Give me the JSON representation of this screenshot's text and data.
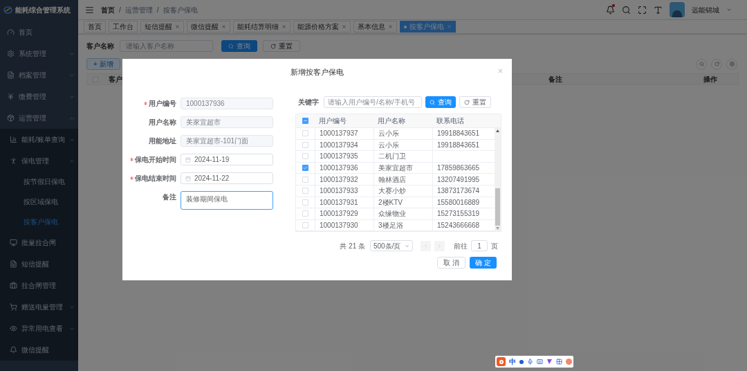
{
  "app_title": "能耗综合管理系统",
  "sidebar": [
    {
      "label": "首页",
      "has_children": false
    },
    {
      "label": "系统管理",
      "expanded": false,
      "has_children": true
    },
    {
      "label": "档案管理",
      "expanded": false,
      "has_children": true
    },
    {
      "label": "缴费管理",
      "expanded": false,
      "has_children": true
    },
    {
      "label": "运营管理",
      "expanded": true,
      "has_children": true,
      "children": [
        {
          "label": "能耗/账单查询",
          "expanded": false,
          "has_children": true
        },
        {
          "label": "保电管理",
          "expanded": true,
          "has_children": true,
          "children": [
            {
              "label": "按节假日保电",
              "selected": false
            },
            {
              "label": "按区域保电",
              "selected": false
            },
            {
              "label": "按客户保电",
              "selected": true
            }
          ]
        },
        {
          "label": "批量拉合闸",
          "has_children": false
        },
        {
          "label": "短信提醒",
          "has_children": false
        },
        {
          "label": "拉合闸管理",
          "has_children": false
        },
        {
          "label": "赠送电量管理",
          "expanded": false,
          "has_children": true
        },
        {
          "label": "异常用电查看",
          "expanded": false,
          "has_children": true
        },
        {
          "label": "微信提醒",
          "has_children": false
        }
      ]
    }
  ],
  "breadcrumb": {
    "separator": "/",
    "items": [
      "首页",
      "运营管理",
      "按客户保电"
    ]
  },
  "user": {
    "name": "远能锦城"
  },
  "tabs": [
    {
      "label": "首页",
      "selected": false,
      "closable": false
    },
    {
      "label": "工作台",
      "selected": false,
      "closable": false
    },
    {
      "label": "短信提醒",
      "selected": false,
      "closable": true
    },
    {
      "label": "微信提醒",
      "selected": false,
      "closable": true
    },
    {
      "label": "能耗结算明细",
      "selected": false,
      "closable": true
    },
    {
      "label": "能源价格方案",
      "selected": false,
      "closable": true
    },
    {
      "label": "基本信息",
      "selected": false,
      "closable": true
    },
    {
      "label": "按客户保电",
      "selected": true,
      "closable": true
    }
  ],
  "search": {
    "label": "客户名称",
    "placeholder": "请输入客户名称",
    "search_button": "查询",
    "reset_button": "重置"
  },
  "add_button": "+ 新增",
  "table": {
    "select_all_checked": false,
    "columns": [
      "客户",
      "备注",
      "操作"
    ]
  },
  "dialog": {
    "title": "新增按客户保电",
    "form": [
      {
        "label": "用户编号",
        "required": true,
        "kind": "disabled",
        "value": "1000137936"
      },
      {
        "label": "用户名称",
        "required": false,
        "kind": "disabled",
        "value": "美家宜超市"
      },
      {
        "label": "用能地址",
        "required": false,
        "kind": "disabled",
        "value": "美家宜超市-101门面"
      },
      {
        "label": "保电开始时间",
        "required": true,
        "kind": "date",
        "value": "2024-11-19"
      },
      {
        "label": "保电结束时间",
        "required": true,
        "kind": "date",
        "value": "2024-11-22"
      },
      {
        "label": "备注",
        "required": false,
        "kind": "textarea",
        "value": "装修期间保电"
      }
    ],
    "keyword": {
      "label": "关键字",
      "placeholder": "请输入用户编号/名称/手机号",
      "search_button": "查询",
      "reset_button": "重置"
    },
    "picker": {
      "indeterminate": true,
      "columns": [
        "用户编号",
        "用户名称",
        "联系电话"
      ],
      "rows": [
        {
          "checked": false,
          "cells": [
            "1000137937",
            "云小乐",
            "19918843651"
          ]
        },
        {
          "checked": false,
          "cells": [
            "1000137934",
            "云小乐",
            "19918843651"
          ]
        },
        {
          "checked": false,
          "cells": [
            "1000137935",
            "二机门卫",
            ""
          ]
        },
        {
          "checked": true,
          "cells": [
            "1000137936",
            "美家宜超市",
            "17859863665"
          ]
        },
        {
          "checked": false,
          "cells": [
            "1000137932",
            "翰林酒店",
            "13207491995"
          ]
        },
        {
          "checked": false,
          "cells": [
            "1000137933",
            "大赛小炒",
            "13873173674"
          ]
        },
        {
          "checked": false,
          "cells": [
            "1000137931",
            "2楼KTV",
            "15580016889"
          ]
        },
        {
          "checked": false,
          "cells": [
            "1000137929",
            "众缘物业",
            "15273155319"
          ]
        },
        {
          "checked": false,
          "cells": [
            "1000137930",
            "3楼足浴",
            "15243666668"
          ]
        }
      ]
    },
    "pagination": {
      "total": "共 21 条",
      "page_size": "500条/页",
      "goto_label": "前往",
      "page": "1",
      "page_suffix": "页"
    },
    "cancel_button": "取 消",
    "confirm_button": "确 定"
  },
  "ime_toolbar": {
    "mode": "中"
  }
}
